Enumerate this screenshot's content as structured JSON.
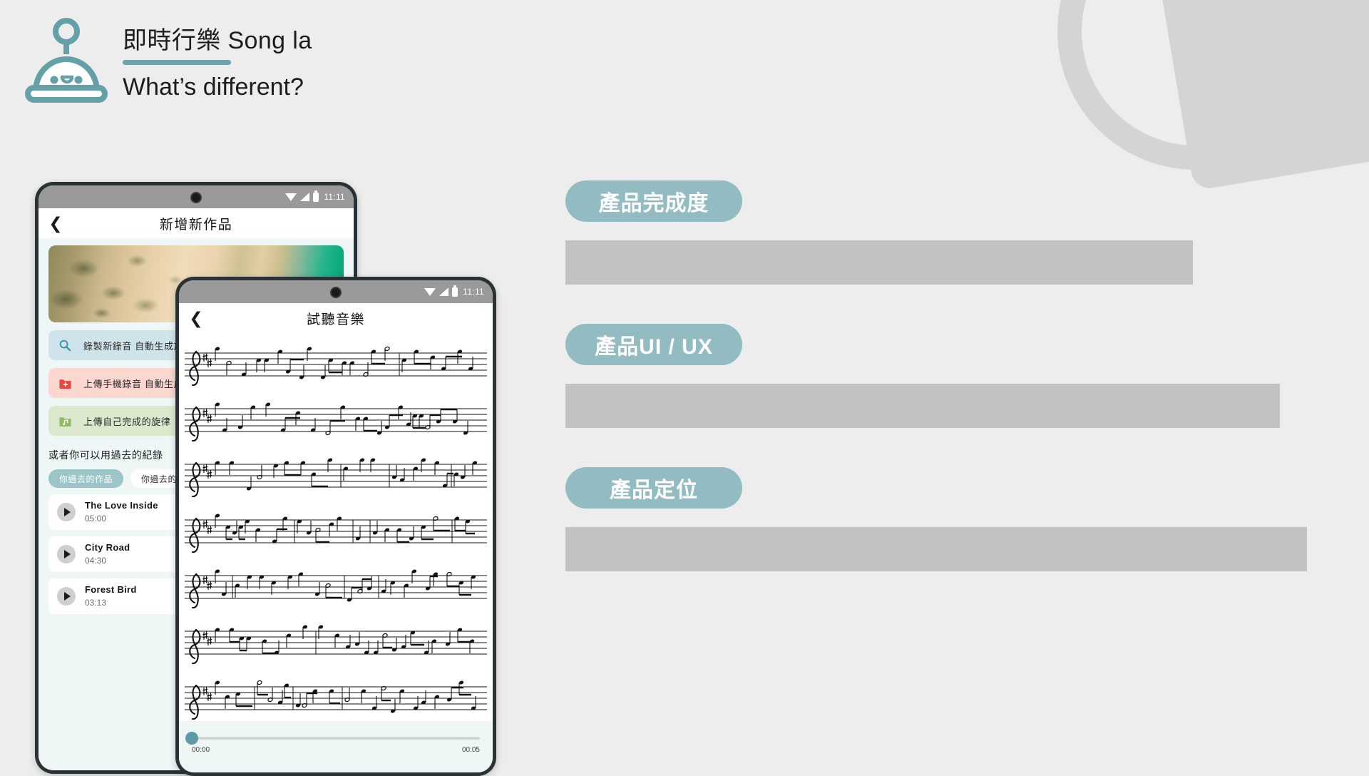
{
  "header": {
    "logo_icon": "robot-bell-mascot-icon",
    "title": "即時行樂 Song la",
    "subtitle": "What’s different?",
    "accent_color": "#6fa3ab"
  },
  "background": {
    "page_color": "#ededed",
    "deco_color": "#d4d4d4",
    "ring_icon": "decorative-ring-shape",
    "square_icon": "decorative-rounded-square-shape"
  },
  "sections": [
    {
      "pill_label": "產品完成度",
      "bar_color": "#c2c2c2"
    },
    {
      "pill_label": "產品UI / UX",
      "bar_color": "#c2c2c2"
    },
    {
      "pill_label": "產品定位",
      "bar_color": "#c2c2c2"
    }
  ],
  "phone_back": {
    "status_bar": {
      "time": "11:11",
      "wifi_icon": "wifi-icon",
      "signal_icon": "signal-icon",
      "battery_icon": "battery-icon",
      "camera_icon": "front-camera-dot-icon"
    },
    "app_bar": {
      "back_icon": "chevron-left-icon",
      "title": "新增新作品"
    },
    "hero_image_alt": "aerial-beach-photo",
    "actions": [
      {
        "icon": "microphone-search-icon",
        "label": "錄製新錄音 自動生成旋律"
      },
      {
        "icon": "upload-folder-red-icon",
        "label": "上傳手機錄音 自動生成旋律"
      },
      {
        "icon": "music-folder-green-icon",
        "label": "上傳自己完成的旋律"
      }
    ],
    "past_heading": "或者你可以用過去的紀錄",
    "tabs": [
      {
        "label": "你過去的作品",
        "active": true
      },
      {
        "label": "你過去的錄音",
        "active": false
      }
    ],
    "songs": [
      {
        "title": "The Love Inside",
        "duration": "05:00",
        "play_icon": "play-icon"
      },
      {
        "title": "City Road",
        "duration": "04:30",
        "play_icon": "play-icon"
      },
      {
        "title": "Forest Bird",
        "duration": "03:13",
        "play_icon": "play-icon"
      }
    ]
  },
  "phone_front": {
    "status_bar": {
      "time": "11:11",
      "wifi_icon": "wifi-icon",
      "signal_icon": "signal-icon",
      "battery_icon": "battery-icon",
      "camera_icon": "front-camera-dot-icon"
    },
    "app_bar": {
      "back_icon": "chevron-left-icon",
      "title": "試聽音樂"
    },
    "score_alt": "musical-staff-notation",
    "player": {
      "current_time": "00:00",
      "total_time": "00:05",
      "progress_percent": 0,
      "thumb_color": "#5b9aa6"
    }
  }
}
